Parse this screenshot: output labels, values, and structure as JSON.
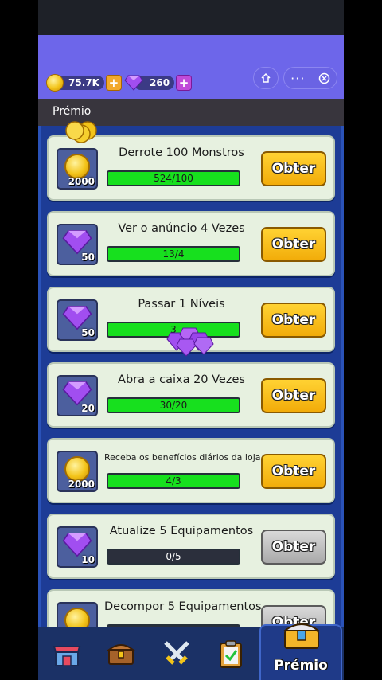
{
  "header": {
    "currencies": [
      {
        "type": "coin",
        "amount": "75.7K"
      },
      {
        "type": "gem",
        "amount": "260"
      }
    ]
  },
  "window_controls": [
    "home-icon",
    "more-icon",
    "close-icon"
  ],
  "section": {
    "title": "Prémio"
  },
  "tasks": [
    {
      "title": "Derrote 100 Monstros",
      "reward_type": "coin",
      "reward_amount": "2000",
      "progress_text": "524/100",
      "progress": 1.0,
      "button": "Obter",
      "button_state": "active"
    },
    {
      "title": "Ver o anúncio 4 Vezes",
      "reward_type": "gem",
      "reward_amount": "50",
      "progress_text": "13/4",
      "progress": 1.0,
      "button": "Obter",
      "button_state": "active"
    },
    {
      "title": "Passar 1 Níveis",
      "reward_type": "gem",
      "reward_amount": "50",
      "progress_text": "3",
      "progress": 1.0,
      "button": "Obter",
      "button_state": "active"
    },
    {
      "title": "Abra a caixa 20 Vezes",
      "reward_type": "gem",
      "reward_amount": "20",
      "progress_text": "30/20",
      "progress": 1.0,
      "button": "Obter",
      "button_state": "active"
    },
    {
      "title": "Receba os benefícios diários da loja",
      "reward_type": "coin",
      "reward_amount": "2000",
      "progress_text": "4/3",
      "progress": 1.0,
      "button": "Obter",
      "button_state": "active"
    },
    {
      "title": "Atualize 5 Equipamentos",
      "reward_type": "gem",
      "reward_amount": "10",
      "progress_text": "0/5",
      "progress": 0.0,
      "button": "Obter",
      "button_state": "disabled"
    },
    {
      "title": "Decompor 5 Equipamentos",
      "reward_type": "coin",
      "reward_amount": "",
      "progress_text": "",
      "progress": 0.0,
      "button": "Obter",
      "button_state": "disabled"
    }
  ],
  "bottom_nav": {
    "items": [
      {
        "icon": "shop-icon"
      },
      {
        "icon": "chest-icon"
      },
      {
        "icon": "battle-swords-icon"
      },
      {
        "icon": "clipboard-icon"
      }
    ],
    "active": {
      "icon": "reward-chest-icon",
      "label": "Prémio"
    }
  },
  "colors": {
    "header": "#6d66ea",
    "list_bg": "#1d3c96",
    "progress_fill": "#17e01e",
    "button_gold": "#f7be1c",
    "button_gray": "#b5b5b5"
  }
}
